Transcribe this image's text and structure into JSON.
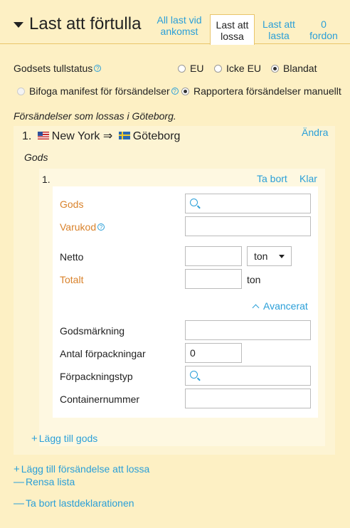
{
  "header": {
    "title": "Last att förtulla",
    "tabs": [
      {
        "line1": "All last vid",
        "line2": "ankomst"
      },
      {
        "line1": "Last att",
        "line2": "lossa"
      },
      {
        "line1": "Last att",
        "line2": "lasta"
      },
      {
        "line1": "0",
        "line2": "fordon"
      }
    ]
  },
  "status": {
    "label": "Godsets tullstatus",
    "options": [
      "EU",
      "Icke EU",
      "Blandat"
    ],
    "selected": "Blandat"
  },
  "manifest": {
    "attach_label": "Bifoga manifest för försändelser",
    "manual_label": "Rapportera försändelser manuellt"
  },
  "shipments_heading": "Försändelser som lossas i Göteborg.",
  "shipment": {
    "number": "1.",
    "origin": "New York",
    "arrow": "⇒",
    "destination": "Göteborg",
    "change_label": "Ändra",
    "goods_heading": "Gods"
  },
  "goods_item": {
    "number": "1.",
    "remove_label": "Ta bort",
    "done_label": "Klar",
    "fields": {
      "gods": "Gods",
      "varukod": "Varukod",
      "netto": "Netto",
      "netto_unit": "ton",
      "totalt": "Totalt",
      "totalt_unit": "ton",
      "advanced": "Avancerat",
      "marking": "Godsmärkning",
      "package_count": "Antal förpackningar",
      "package_count_value": "0",
      "package_type": "Förpackningstyp",
      "container": "Containernummer"
    }
  },
  "actions": {
    "add_goods": "Lägg till gods",
    "add_shipment": "Lägg till försändelse att lossa",
    "clear_list": "Rensa lista",
    "remove_declaration": "Ta bort lastdeklarationen"
  },
  "colors": {
    "background": "#fdf0c4",
    "link": "#2a9fd8",
    "required_label": "#d9822b"
  }
}
